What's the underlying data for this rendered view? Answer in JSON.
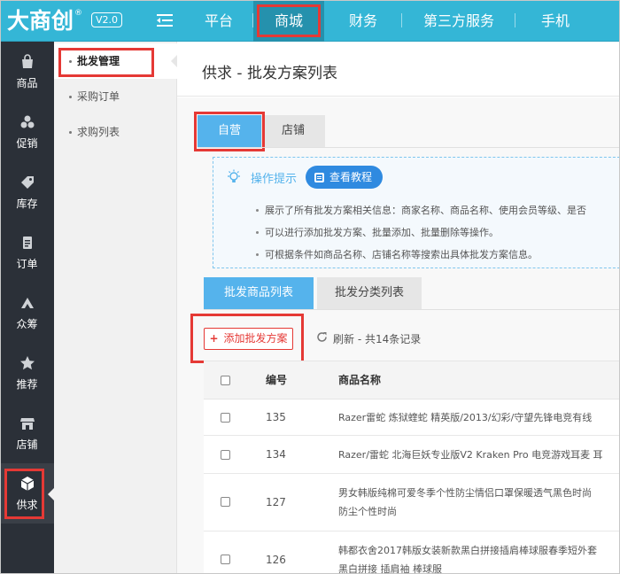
{
  "app": {
    "logo": "大商创",
    "logo_mark": "®",
    "version": "V2.0"
  },
  "topnav": [
    {
      "label": "平台"
    },
    {
      "label": "商城"
    },
    {
      "label": "财务"
    },
    {
      "label": "第三方服务"
    },
    {
      "label": "手机"
    }
  ],
  "sidebar": [
    {
      "label": "商品",
      "icon": "bag-icon"
    },
    {
      "label": "促销",
      "icon": "promo-icon"
    },
    {
      "label": "库存",
      "icon": "tag-icon"
    },
    {
      "label": "订单",
      "icon": "order-icon"
    },
    {
      "label": "众筹",
      "icon": "crowdfund-icon"
    },
    {
      "label": "推荐",
      "icon": "star-icon"
    },
    {
      "label": "店铺",
      "icon": "store-icon"
    },
    {
      "label": "供求",
      "icon": "cube-icon"
    }
  ],
  "subnav": [
    {
      "label": "批发管理"
    },
    {
      "label": "采购订单"
    },
    {
      "label": "求购列表"
    }
  ],
  "page": {
    "title": "供求 - 批发方案列表"
  },
  "tabs_top": [
    {
      "label": "自营"
    },
    {
      "label": "店铺"
    }
  ],
  "tips": {
    "title": "操作提示",
    "button": "查看教程",
    "items": [
      "展示了所有批发方案相关信息：商家名称、商品名称、使用会员等级、是否",
      "可以进行添加批发方案、批量添加、批量删除等操作。",
      "可根据条件如商品名称、店铺名称等搜索出具体批发方案信息。"
    ]
  },
  "tabs_list": [
    {
      "label": "批发商品列表"
    },
    {
      "label": "批发分类列表"
    }
  ],
  "toolbar": {
    "add_label": "添加批发方案",
    "refresh_label": "刷新 - 共14条记录"
  },
  "table": {
    "columns": [
      "编号",
      "商品名称"
    ],
    "rows": [
      {
        "id": "135",
        "name": [
          "Razer雷蛇 炼狱蝰蛇 精英版/2013/幻彩/守望先锋电竞有线"
        ]
      },
      {
        "id": "134",
        "name": [
          "Razer/雷蛇 北海巨妖专业版V2 Kraken Pro 电竞游戏耳麦 耳"
        ]
      },
      {
        "id": "127",
        "name": [
          "男女韩版纯棉可爱冬季个性防尘情侣口罩保暖透气黑色时尚",
          "防尘个性时尚"
        ]
      },
      {
        "id": "126",
        "name": [
          "韩都衣舍2017韩版女装新款黑白拼接插肩棒球服春季短外套",
          "黑白拼接 插肩袖 棒球服"
        ]
      }
    ]
  }
}
